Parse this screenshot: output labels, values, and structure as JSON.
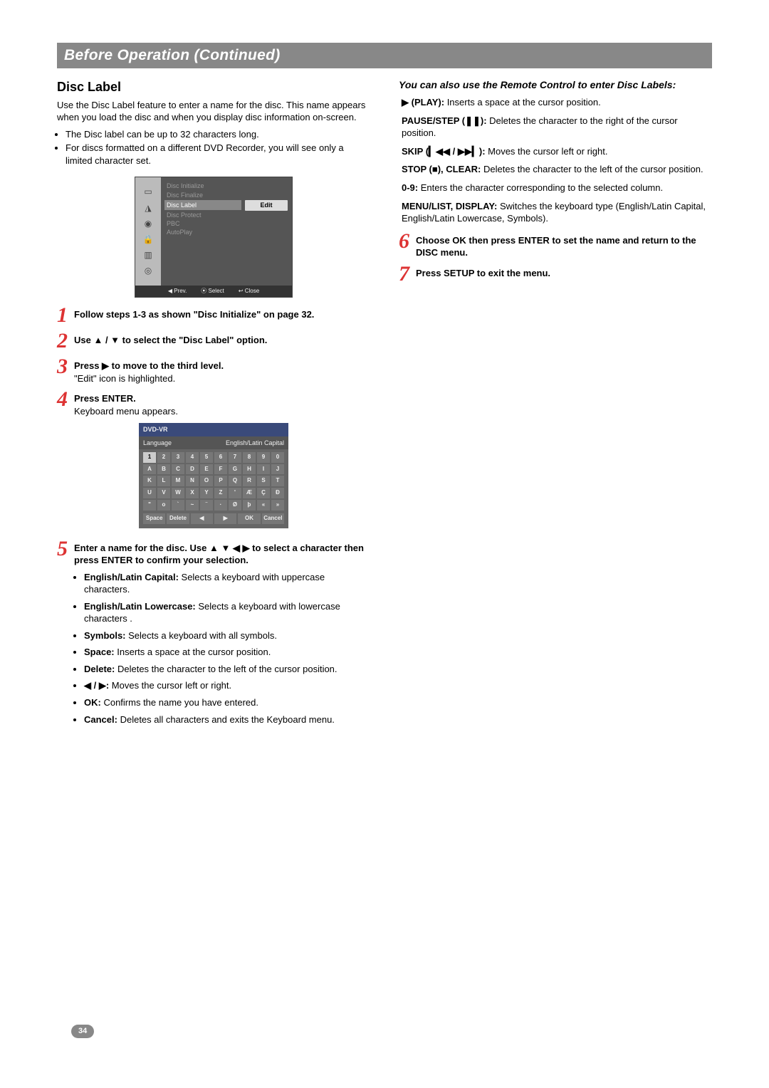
{
  "title": "Before Operation (Continued)",
  "page_number": "34",
  "left": {
    "h2": "Disc Label",
    "intro": "Use the Disc Label feature to enter a name for the disc. This name appears when you load the disc and when you display disc information on-screen.",
    "notes": [
      "The Disc label can be up to 32 characters long.",
      "For discs formatted on a different DVD Recorder, you will see only a limited character set."
    ],
    "menu": {
      "items": [
        "Disc Initialize",
        "Disc Finalize",
        "Disc Label",
        "Disc Protect",
        "PBC",
        "AutoPlay"
      ],
      "selected": "Disc Label",
      "button": "Edit",
      "foot_prev": "◀ Prev.",
      "foot_select": "⦿ Select",
      "foot_close": "↩ Close"
    },
    "steps": {
      "s1": "Follow steps 1-3 as shown \"Disc Initialize\" on page 32.",
      "s2": "Use ▲ / ▼ to select the \"Disc Label\" option.",
      "s3a": "Press ▶ to move to the third level.",
      "s3b": "\"Edit\" icon is highlighted.",
      "s4a": "Press ENTER.",
      "s4b": "Keyboard menu appears."
    },
    "keyboard": {
      "title": "DVD-VR",
      "lang_label": "Language",
      "lang_value": "English/Latin Capital",
      "rows": [
        [
          "1",
          "2",
          "3",
          "4",
          "5",
          "6",
          "7",
          "8",
          "9",
          "0"
        ],
        [
          "A",
          "B",
          "C",
          "D",
          "E",
          "F",
          "G",
          "H",
          "I",
          "J"
        ],
        [
          "K",
          "L",
          "M",
          "N",
          "O",
          "P",
          "Q",
          "R",
          "S",
          "T"
        ],
        [
          "U",
          "V",
          "W",
          "X",
          "Y",
          "Z",
          "'",
          "Æ",
          "Ç",
          "Ð"
        ],
        [
          "\"",
          "o",
          "`",
          "~",
          "¨",
          "·",
          "Ø",
          "þ",
          "«",
          "»"
        ]
      ],
      "bottom": [
        "Space",
        "Delete",
        "◀",
        "▶",
        "OK",
        "Cancel"
      ]
    },
    "step5_lead": "Enter a name for the disc. Use ▲ ▼ ◀ ▶ to select a character then press ENTER to confirm your selection.",
    "step5_items": [
      {
        "b": "English/Latin Capital:",
        "t": " Selects a keyboard with uppercase characters."
      },
      {
        "b": "English/Latin Lowercase:",
        "t": " Selects a keyboard with lowercase characters ."
      },
      {
        "b": "Symbols:",
        "t": " Selects a keyboard with all symbols."
      },
      {
        "b": "Space:",
        "t": " Inserts a space at the cursor position."
      },
      {
        "b": "Delete:",
        "t": " Deletes the character to the left of the cursor position."
      },
      {
        "b": "◀ / ▶:",
        "t": " Moves the cursor left or right."
      },
      {
        "b": "OK:",
        "t": " Confirms the name you have entered."
      },
      {
        "b": "Cancel:",
        "t": " Deletes all characters and exits the Keyboard menu."
      }
    ]
  },
  "right": {
    "h3": "You can also use the Remote Control to enter Disc Labels:",
    "items": [
      {
        "b": "▶ (PLAY):",
        "t": " Inserts a space at the cursor position."
      },
      {
        "b": "PAUSE/STEP (❚❚):",
        "t": " Deletes the character to the right of the cursor position."
      },
      {
        "b": "SKIP (▎◀◀ / ▶▶▎):",
        "t": " Moves the cursor left or right."
      },
      {
        "b": "STOP (■), CLEAR:",
        "t": " Deletes the character to the left of the cursor position."
      },
      {
        "b": "0-9:",
        "t": " Enters the character corresponding to the selected column."
      },
      {
        "b": "MENU/LIST, DISPLAY:",
        "t": " Switches the keyboard type (English/Latin Capital, English/Latin Lowercase, Symbols)."
      }
    ],
    "s6": "Choose OK then press ENTER to set the name and return to the DISC menu.",
    "s7": "Press SETUP to exit the menu."
  }
}
